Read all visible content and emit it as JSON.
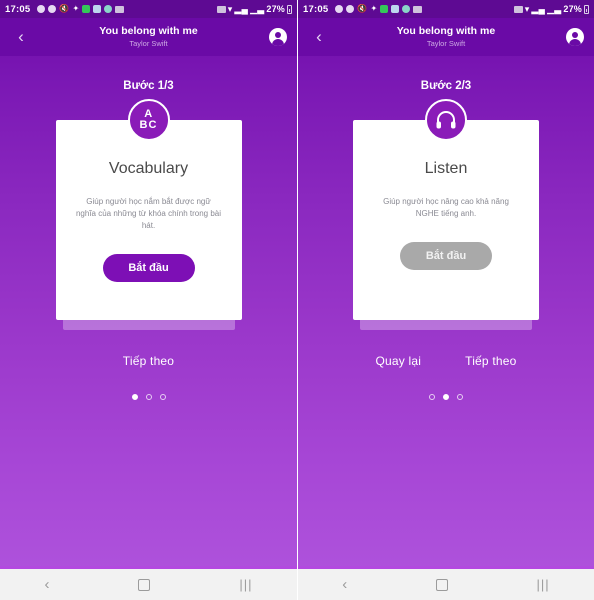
{
  "statusbar": {
    "time": "17:05",
    "left_icons": [
      "message-icon",
      "chat-icon",
      "mute-icon",
      "bluetooth-icon",
      "app-green-icon",
      "download-icon",
      "shield-icon",
      "photo-icon"
    ],
    "right_icons": [
      "alarm-icon",
      "wifi-icon",
      "signal-icon",
      "signal-bars-icon"
    ],
    "battery": "27%",
    "battery_icon": "battery-icon"
  },
  "header": {
    "back_icon": "chevron-left-icon",
    "title": "You belong with me",
    "subtitle": "Taylor Swift",
    "avatar_icon": "account-circle-icon"
  },
  "screens": [
    {
      "step": "Bước 1/3",
      "badge_icon": "abc-icon",
      "badge_line1": "A",
      "badge_line2": "BC",
      "card_title": "Vocabulary",
      "card_desc": "Giúp người học nắm bắt được ngữ nghĩa của những từ khóa chính trong bài hát.",
      "cta_label": "Bắt đầu",
      "cta_enabled": true,
      "cta_color": "#7d0fb5",
      "nav_links": [
        "Tiếp theo"
      ],
      "dots": [
        true,
        false,
        false
      ]
    },
    {
      "step": "Bước 2/3",
      "badge_icon": "headphones-icon",
      "card_title": "Listen",
      "card_desc": "Giúp người học nâng cao khả năng NGHE tiếng anh.",
      "cta_label": "Bắt đầu",
      "cta_enabled": false,
      "cta_color": "#a9a9a9",
      "nav_links": [
        "Quay lại",
        "Tiếp theo"
      ],
      "dots": [
        false,
        true,
        false
      ]
    }
  ],
  "bottomnav": {
    "back_icon": "nav-back-icon",
    "home_icon": "nav-home-icon",
    "recents_icon": "nav-recents-icon",
    "back_label": "‹",
    "recents_label": "|||"
  },
  "theme": {
    "gradient_top": "#6d0aa9",
    "gradient_bottom": "#b055dd",
    "appbar": "#6a0aa6",
    "accent": "#8a1bb8",
    "bottomnav_bg": "#f2f2f2"
  }
}
